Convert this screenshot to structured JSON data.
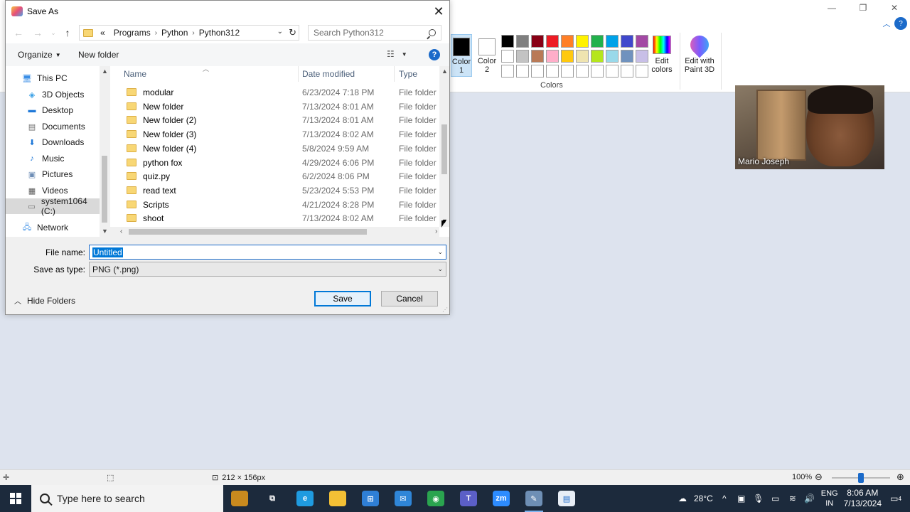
{
  "paint": {
    "titlebar_buttons": [
      "—",
      "❐",
      "✕"
    ],
    "color1_label": "Color 1",
    "color2_label": "Color 2",
    "palette": [
      "#000000",
      "#7f7f7f",
      "#880015",
      "#ed1c24",
      "#ff7f27",
      "#fff200",
      "#22b14c",
      "#00a2e8",
      "#3f48cc",
      "#a349a4",
      "#ffffff",
      "#c3c3c3",
      "#b97a57",
      "#ffaec9",
      "#ffc90e",
      "#efe4b0",
      "#b5e61d",
      "#99d9ea",
      "#7092be",
      "#c8bfe7",
      "#ffffff",
      "#ffffff",
      "#ffffff",
      "#ffffff",
      "#ffffff",
      "#ffffff",
      "#ffffff",
      "#ffffff",
      "#ffffff",
      "#ffffff"
    ],
    "edit_colors_label": "Edit colors",
    "edit_paint3d_label": "Edit with Paint 3D",
    "colors_group_label": "Colors",
    "webcam_name": "Mario Joseph",
    "status": {
      "dimensions": "212 × 156px",
      "zoom": "100%",
      "zoom_level": 0.5
    }
  },
  "dialog": {
    "title": "Save As",
    "breadcrumbs": [
      "«",
      "Programs",
      "Python",
      "Python312"
    ],
    "search_placeholder": "Search Python312",
    "organize_label": "Organize",
    "new_folder_label": "New folder",
    "nav_items": [
      {
        "label": "This PC",
        "icon": "pc-icon"
      },
      {
        "label": "3D Objects",
        "icon": "cube-icon"
      },
      {
        "label": "Desktop",
        "icon": "desktop-icon"
      },
      {
        "label": "Documents",
        "icon": "document-icon"
      },
      {
        "label": "Downloads",
        "icon": "download-icon"
      },
      {
        "label": "Music",
        "icon": "music-icon"
      },
      {
        "label": "Pictures",
        "icon": "picture-icon"
      },
      {
        "label": "Videos",
        "icon": "video-icon"
      },
      {
        "label": "system1064 (C:)",
        "icon": "drive-icon"
      },
      {
        "label": "Network",
        "icon": "network-icon"
      }
    ],
    "columns": {
      "name": "Name",
      "date": "Date modified",
      "type": "Type"
    },
    "files": [
      {
        "name": "modular",
        "date": "6/23/2024 7:18 PM",
        "type": "File folder"
      },
      {
        "name": "New folder",
        "date": "7/13/2024 8:01 AM",
        "type": "File folder"
      },
      {
        "name": "New folder (2)",
        "date": "7/13/2024 8:01 AM",
        "type": "File folder"
      },
      {
        "name": "New folder (3)",
        "date": "7/13/2024 8:02 AM",
        "type": "File folder"
      },
      {
        "name": "New folder (4)",
        "date": "5/8/2024 9:59 AM",
        "type": "File folder"
      },
      {
        "name": "python fox",
        "date": "4/29/2024 6:06 PM",
        "type": "File folder"
      },
      {
        "name": "quiz.py",
        "date": "6/2/2024 8:06 PM",
        "type": "File folder"
      },
      {
        "name": "read text",
        "date": "5/23/2024 5:53 PM",
        "type": "File folder"
      },
      {
        "name": "Scripts",
        "date": "4/21/2024 8:28 PM",
        "type": "File folder"
      },
      {
        "name": "shoot",
        "date": "7/13/2024 8:02 AM",
        "type": "File folder"
      }
    ],
    "file_name_label": "File name:",
    "file_name_value": "Untitled",
    "save_type_label": "Save as type:",
    "save_type_value": "PNG (*.png)",
    "hide_folders_label": "Hide Folders",
    "save_label": "Save",
    "cancel_label": "Cancel"
  },
  "taskbar": {
    "search_placeholder": "Type here to search",
    "apps": [
      {
        "name": "toolbox-app",
        "color": "#c98a1e",
        "glyph": ""
      },
      {
        "name": "task-view",
        "color": "transparent",
        "glyph": "⧉"
      },
      {
        "name": "edge-app",
        "color": "#1f9be0",
        "glyph": "e"
      },
      {
        "name": "file-explorer-app",
        "color": "#f3c035",
        "glyph": ""
      },
      {
        "name": "store-app",
        "color": "#2f7fd6",
        "glyph": "⊞"
      },
      {
        "name": "mail-app",
        "color": "#2f86d8",
        "glyph": "✉"
      },
      {
        "name": "chrome-app",
        "color": "#2aa44f",
        "glyph": "◉"
      },
      {
        "name": "teams-app",
        "color": "#5b5fc7",
        "glyph": "T"
      },
      {
        "name": "zoom-app",
        "color": "#2d8cff",
        "glyph": "zm"
      },
      {
        "name": "paint-app",
        "color": "#6e8fb5",
        "glyph": "✎"
      },
      {
        "name": "paint-file-app",
        "color": "#e8eef6",
        "glyph": "▤"
      }
    ],
    "temperature": "28°C",
    "lang_top": "ENG",
    "lang_bottom": "IN",
    "time": "8:06 AM",
    "date": "7/13/2024",
    "notifications": "4"
  }
}
